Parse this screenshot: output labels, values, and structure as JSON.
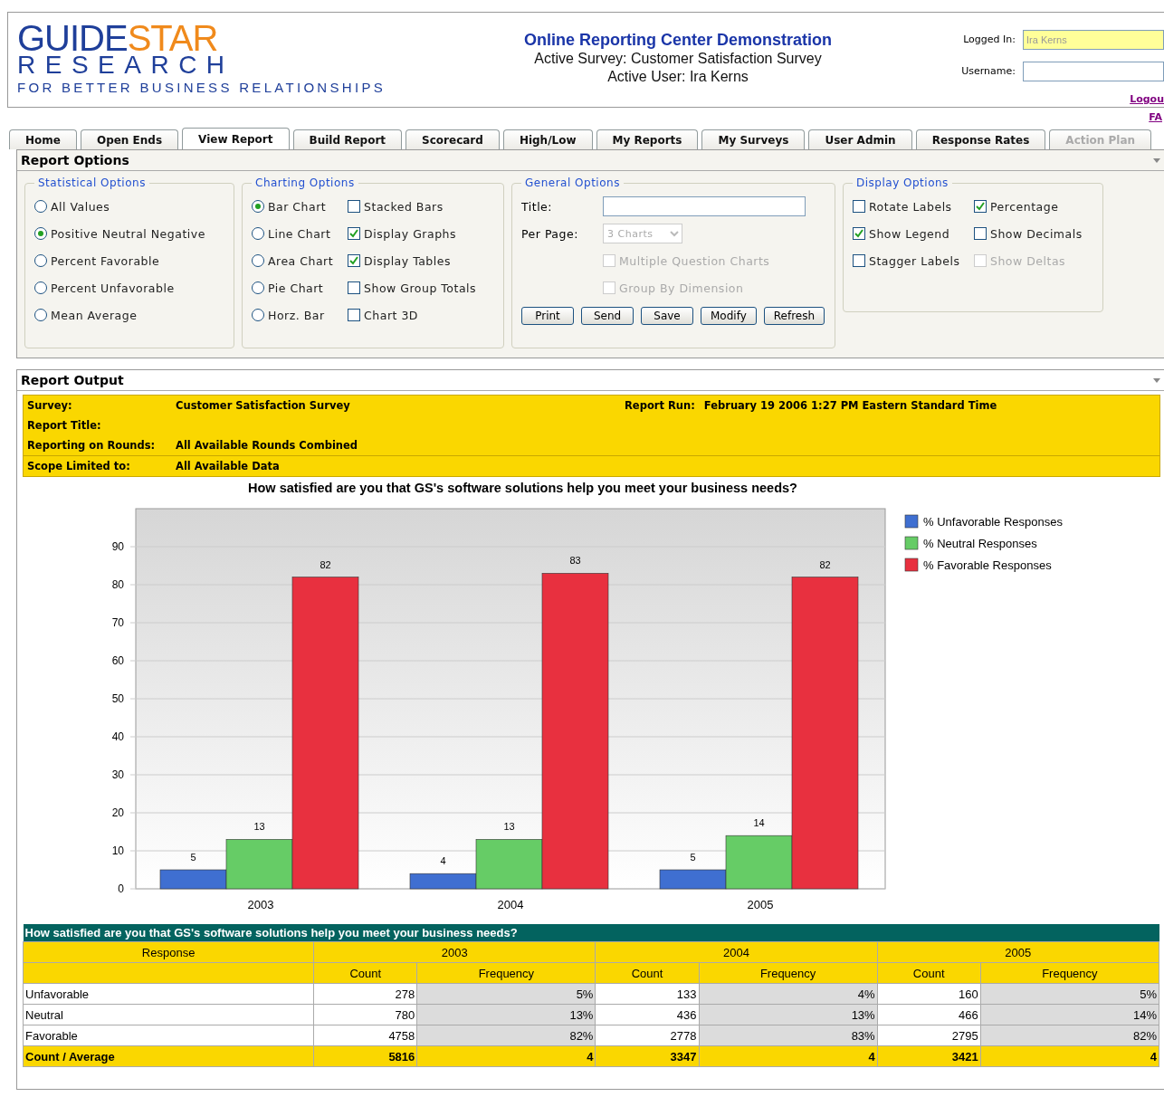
{
  "header": {
    "logo": {
      "primary": "GUIDE",
      "accent": "STAR",
      "line2": "RESEARCH",
      "tagline": "FOR BETTER BUSINESS RELATIONSHIPS"
    },
    "title": "Online Reporting Center Demonstration",
    "subtitle": "Active Survey: Customer Satisfaction Survey",
    "user_line": "Active User: Ira Kerns",
    "login": {
      "logged_in_label": "Logged In:",
      "logged_in_value": "Ira Kerns",
      "username_label": "Username:",
      "logout": "Logou"
    },
    "faq": "FA"
  },
  "tabs": [
    {
      "label": "Home",
      "selected": false,
      "disabled": false
    },
    {
      "label": "Open Ends",
      "selected": false,
      "disabled": false
    },
    {
      "label": "View Report",
      "selected": true,
      "disabled": false
    },
    {
      "label": "Build Report",
      "selected": false,
      "disabled": false
    },
    {
      "label": "Scorecard",
      "selected": false,
      "disabled": false
    },
    {
      "label": "High/Low",
      "selected": false,
      "disabled": false
    },
    {
      "label": "My Reports",
      "selected": false,
      "disabled": false
    },
    {
      "label": "My Surveys",
      "selected": false,
      "disabled": false
    },
    {
      "label": "User Admin",
      "selected": false,
      "disabled": false
    },
    {
      "label": "Response Rates",
      "selected": false,
      "disabled": false
    },
    {
      "label": "Action Plan",
      "selected": false,
      "disabled": true
    }
  ],
  "report_options": {
    "title": "Report Options",
    "statistical": {
      "legend": "Statistical Options",
      "items": [
        {
          "label": "All Values",
          "selected": false
        },
        {
          "label": "Positive Neutral Negative",
          "selected": true
        },
        {
          "label": "Percent Favorable",
          "selected": false
        },
        {
          "label": "Percent Unfavorable",
          "selected": false
        },
        {
          "label": "Mean Average",
          "selected": false
        }
      ]
    },
    "charting": {
      "legend": "Charting Options",
      "chart_types": [
        {
          "label": "Bar Chart",
          "selected": true
        },
        {
          "label": "Line Chart",
          "selected": false
        },
        {
          "label": "Area Chart",
          "selected": false
        },
        {
          "label": "Pie Chart",
          "selected": false
        },
        {
          "label": "Horz. Bar",
          "selected": false
        }
      ],
      "flags": [
        {
          "label": "Stacked Bars",
          "checked": false
        },
        {
          "label": "Display Graphs",
          "checked": true
        },
        {
          "label": "Display Tables",
          "checked": true
        },
        {
          "label": "Show Group Totals",
          "checked": false
        },
        {
          "label": "Chart 3D",
          "checked": false
        }
      ]
    },
    "general": {
      "legend": "General Options",
      "title_label": "Title:",
      "per_page_label": "Per Page:",
      "per_page_value": "3 Charts",
      "per_page_disabled": true,
      "checkboxes": [
        {
          "label": "Multiple Question Charts",
          "checked": false,
          "disabled": true
        },
        {
          "label": "Group By Dimension",
          "checked": false,
          "disabled": true
        }
      ],
      "buttons": [
        "Print",
        "Send",
        "Save",
        "Modify",
        "Refresh"
      ]
    },
    "display": {
      "legend": "Display Options",
      "items": [
        {
          "label": "Rotate Labels",
          "checked": false,
          "disabled": false
        },
        {
          "label": "Percentage",
          "checked": true,
          "disabled": false
        },
        {
          "label": "Show Legend",
          "checked": true,
          "disabled": false
        },
        {
          "label": "Show Decimals",
          "checked": false,
          "disabled": false
        },
        {
          "label": "Stagger Labels",
          "checked": false,
          "disabled": false
        },
        {
          "label": "Show Deltas",
          "checked": false,
          "disabled": true
        }
      ]
    }
  },
  "report_output": {
    "title": "Report Output",
    "info": [
      {
        "label": "Survey:",
        "value": "Customer Satisfaction Survey",
        "extra_label": "Report Run:",
        "extra_value": "February 19 2006 1:27 PM Eastern Standard Time"
      },
      {
        "label": "Report Title:"
      },
      {
        "label": "Reporting on Rounds:",
        "value": "All Available Rounds Combined"
      },
      {
        "label": "Scope Limited to:",
        "value": "All Available Data"
      }
    ],
    "chart_title": "How satisfied are you that GS's software solutions help you meet your business needs?",
    "chart_data": {
      "type": "bar",
      "categories": [
        "2003",
        "2004",
        "2005"
      ],
      "grid": true,
      "legend": "right",
      "ylim": [
        0,
        100
      ],
      "yticks": [
        0,
        10,
        20,
        30,
        40,
        50,
        60,
        70,
        80,
        90
      ],
      "data_labels": true,
      "series": [
        {
          "name": "% Unfavorable Responses",
          "color": "#3f6fd1",
          "values": [
            5,
            4,
            5
          ]
        },
        {
          "name": "% Neutral Responses",
          "color": "#66cc66",
          "values": [
            13,
            13,
            14
          ]
        },
        {
          "name": "% Favorable Responses",
          "color": "#e8303f",
          "values": [
            82,
            83,
            82
          ]
        }
      ]
    },
    "table": {
      "title": "How satisfied are you that GS's software solutions help you meet your business needs?",
      "response_header": "Response",
      "years": [
        {
          "year": "2003",
          "sub_headers": [
            "Count",
            "Frequency"
          ]
        },
        {
          "year": "2004",
          "sub_headers": [
            "Count",
            "Frequency"
          ]
        },
        {
          "year": "2005",
          "sub_headers": [
            "Count",
            "Frequency"
          ]
        }
      ],
      "rows": [
        {
          "cells": [
            "Unfavorable",
            "278",
            "5%",
            "133",
            "4%",
            "160",
            "5%"
          ]
        },
        {
          "cells": [
            "Neutral",
            "780",
            "13%",
            "436",
            "13%",
            "466",
            "14%"
          ]
        },
        {
          "cells": [
            "Favorable",
            "4758",
            "82%",
            "2778",
            "83%",
            "2795",
            "82%"
          ]
        }
      ],
      "total": {
        "cells": [
          "Count / Average",
          "5816",
          "4",
          "3347",
          "4",
          "3421",
          "4"
        ]
      }
    }
  }
}
